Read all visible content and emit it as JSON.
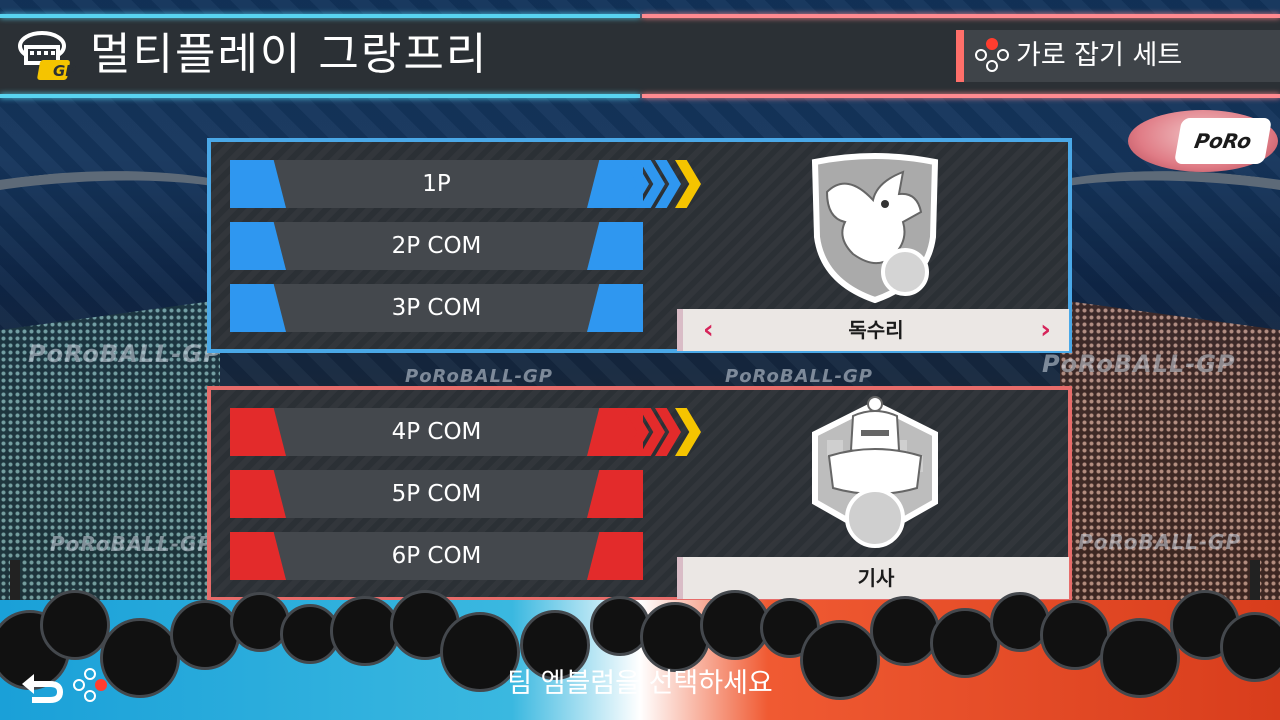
{
  "header": {
    "title": "멀티플레이 그랑프리",
    "logo_text": "GP",
    "control_hint": "가로 잡기 세트"
  },
  "background": {
    "banner_text": "PoRoBALL-GP",
    "blimp_text": "PoRo"
  },
  "teams": [
    {
      "color": "#2f97f0",
      "border_color": "#4aa8e7",
      "players": [
        {
          "label": "1P",
          "selected": true
        },
        {
          "label": "2P COM",
          "selected": false
        },
        {
          "label": "3P COM",
          "selected": false
        }
      ],
      "emblem": {
        "icon": "eagle-emblem-icon",
        "name": "독수리",
        "has_arrows": true
      }
    },
    {
      "color": "#e32b2b",
      "border_color": "#e76c6a",
      "players": [
        {
          "label": "4P COM",
          "selected": true
        },
        {
          "label": "5P COM",
          "selected": false
        },
        {
          "label": "6P COM",
          "selected": false
        }
      ],
      "emblem": {
        "icon": "knight-emblem-icon",
        "name": "기사",
        "has_arrows": false
      }
    }
  ],
  "footer": {
    "instruction": "팀 엠블럼을 선택하세요",
    "back_icon": "back-arrow-icon"
  },
  "colors": {
    "accent_yellow": "#f5c400",
    "arrow_pink": "#d6245a"
  }
}
